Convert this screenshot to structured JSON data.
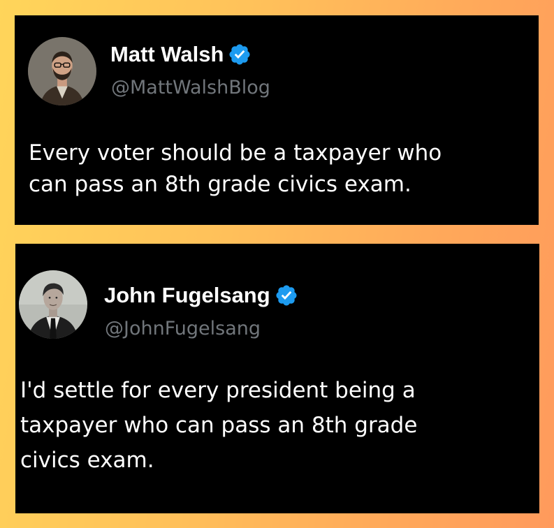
{
  "tweets": [
    {
      "author": {
        "name": "Matt Walsh",
        "handle": "@MattWalshBlog",
        "verified": true,
        "avatar_icon": "profile-photo-matt-walsh"
      },
      "text": "Every voter should be a taxpayer who\ncan pass an 8th grade civics exam."
    },
    {
      "author": {
        "name": "John Fugelsang",
        "handle": "@JohnFugelsang",
        "verified": true,
        "avatar_icon": "profile-photo-john-fugelsang"
      },
      "text": "I'd settle for every president being a\ntaxpayer who can pass an 8th grade\ncivics exam."
    }
  ],
  "colors": {
    "card_background": "#000000",
    "name_text": "#ffffff",
    "handle_text": "#71767b",
    "verified_badge": "#1d9bf0",
    "page_gradient_start": "#ffd55a",
    "page_gradient_end": "#ff9a5c"
  }
}
